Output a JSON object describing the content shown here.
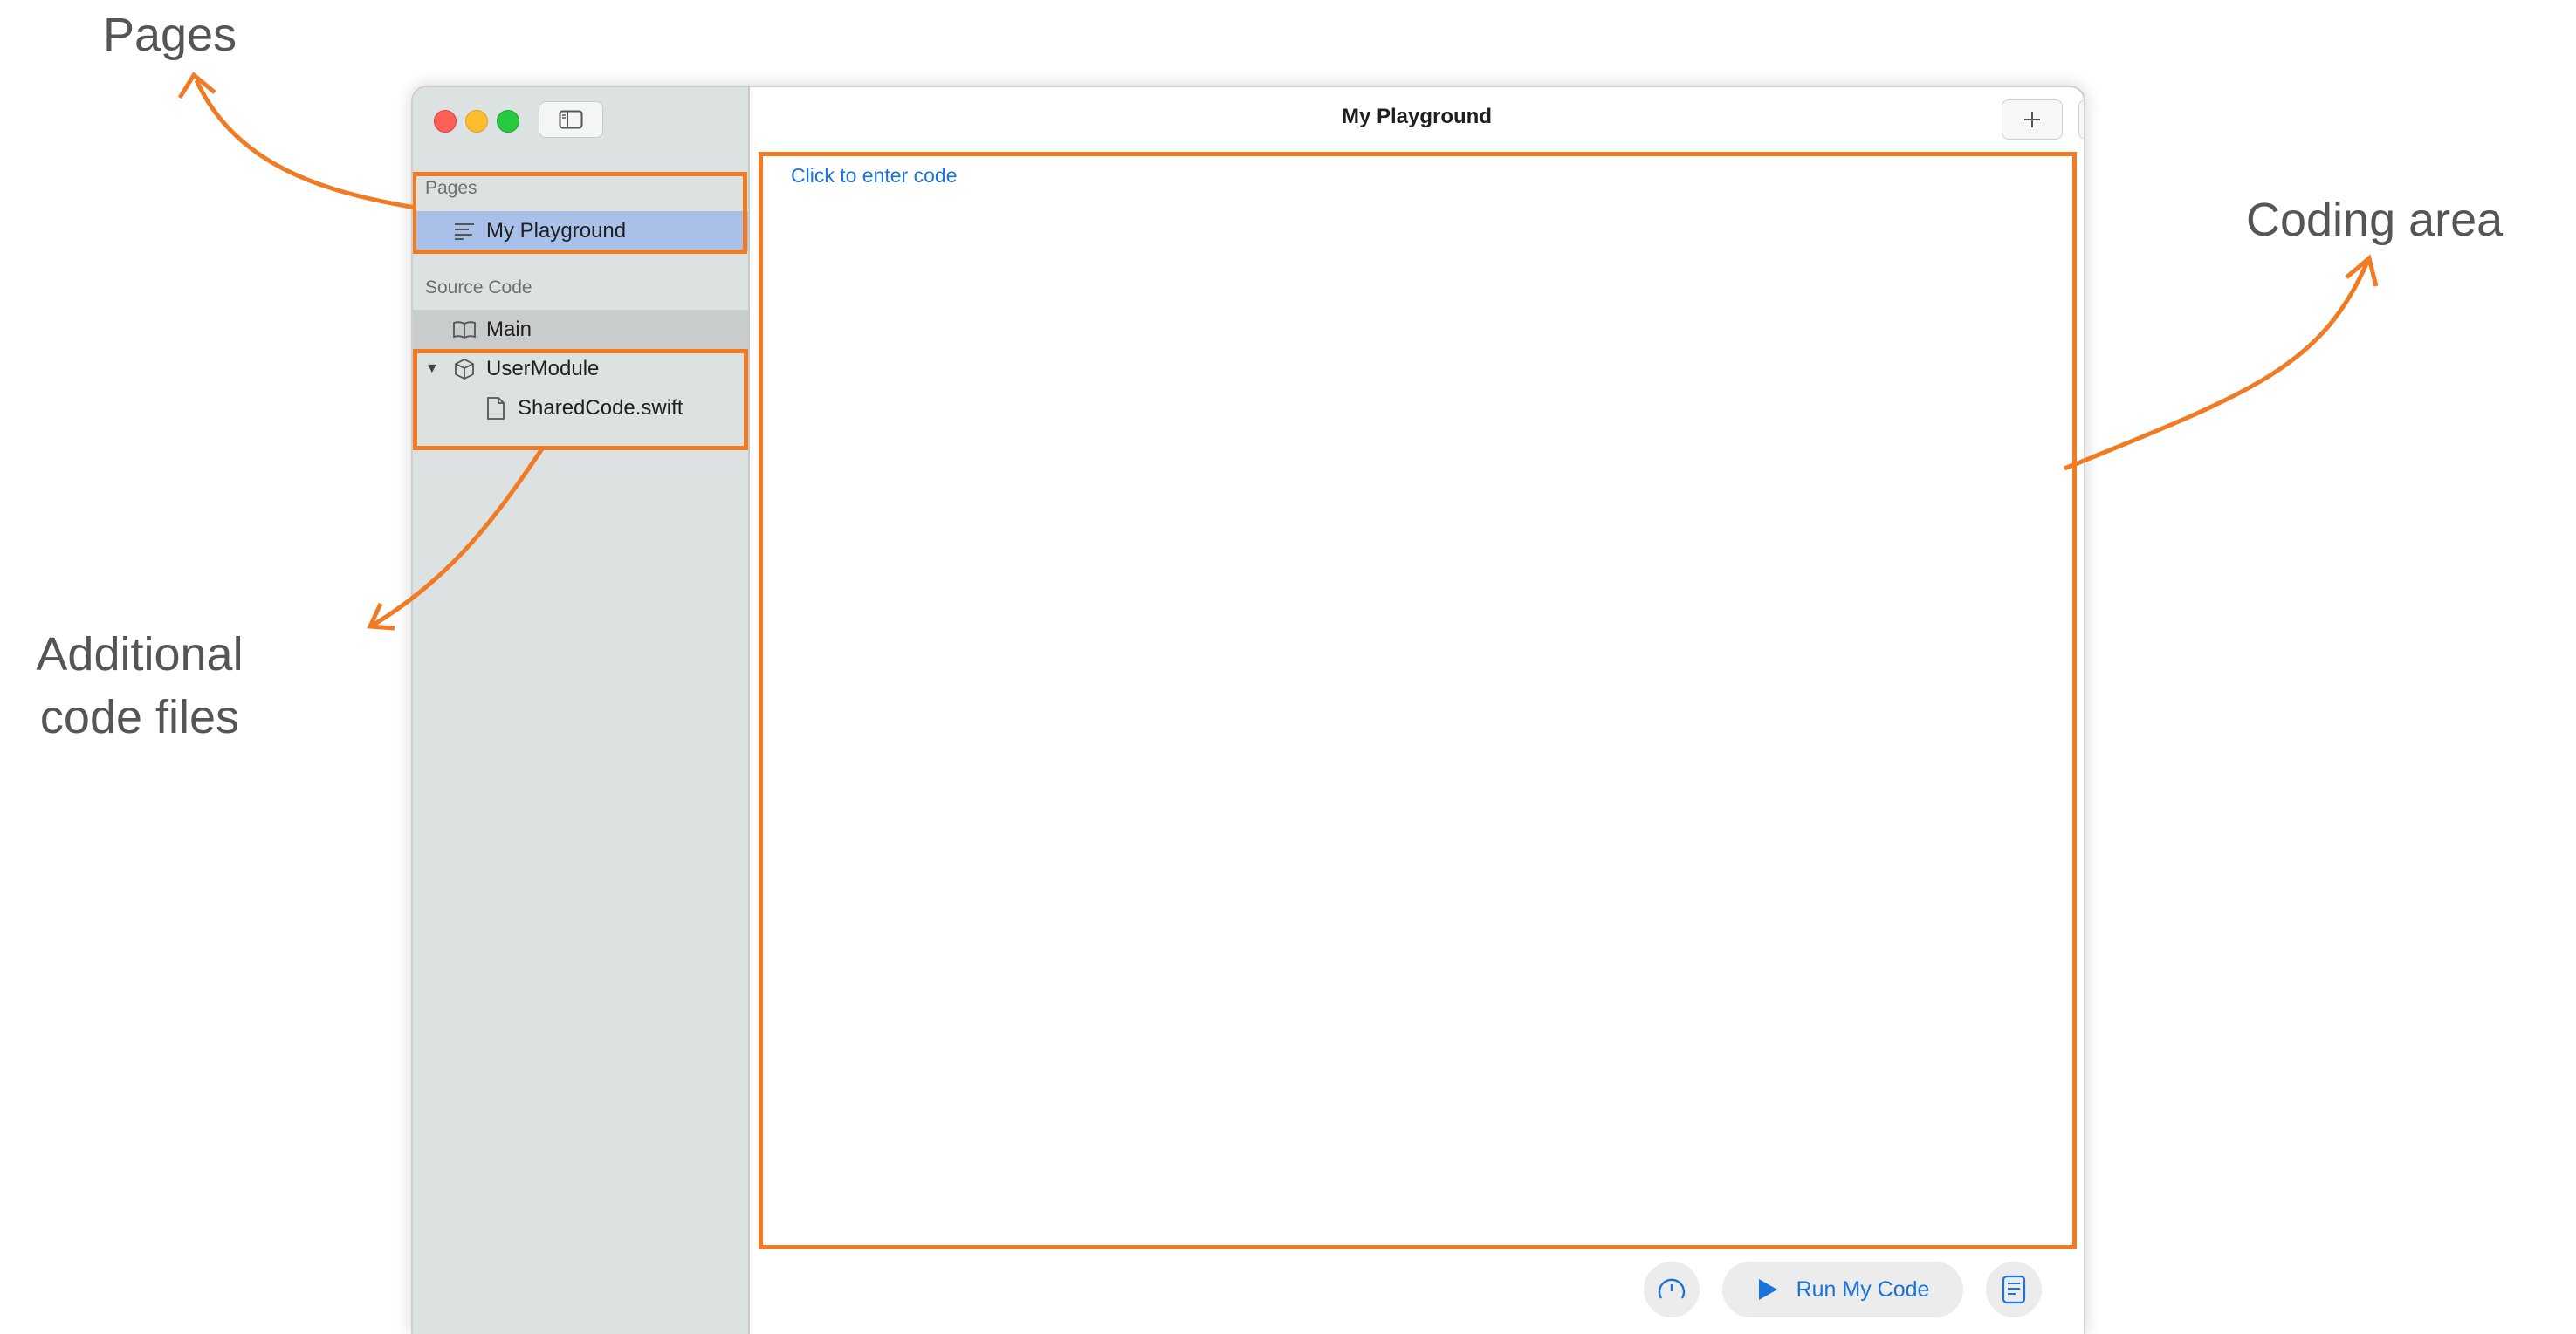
{
  "annotations": {
    "pages": "Pages",
    "coding_area": "Coding area",
    "additional_line1": "Additional",
    "additional_line2": "code files"
  },
  "window": {
    "title": "My Playground",
    "toolbar": {
      "add_icon": "plus-icon",
      "share_icon": "share-icon"
    }
  },
  "sidebar": {
    "pages_section": "Pages",
    "pages": [
      {
        "label": "My Playground",
        "icon": "page-lines-icon",
        "selected": true
      }
    ],
    "source_section": "Source Code",
    "source_items": [
      {
        "label": "Main",
        "icon": "book-icon"
      },
      {
        "label": "UserModule",
        "icon": "cube-icon",
        "expanded": true
      },
      {
        "label": "SharedCode.swift",
        "icon": "file-icon"
      }
    ]
  },
  "editor": {
    "placeholder": "Click to enter code"
  },
  "bottom_bar": {
    "run_label": "Run My Code"
  },
  "colors": {
    "highlight": "#f07b22",
    "accent": "#1a73d9",
    "selection": "#a9c1e8"
  }
}
